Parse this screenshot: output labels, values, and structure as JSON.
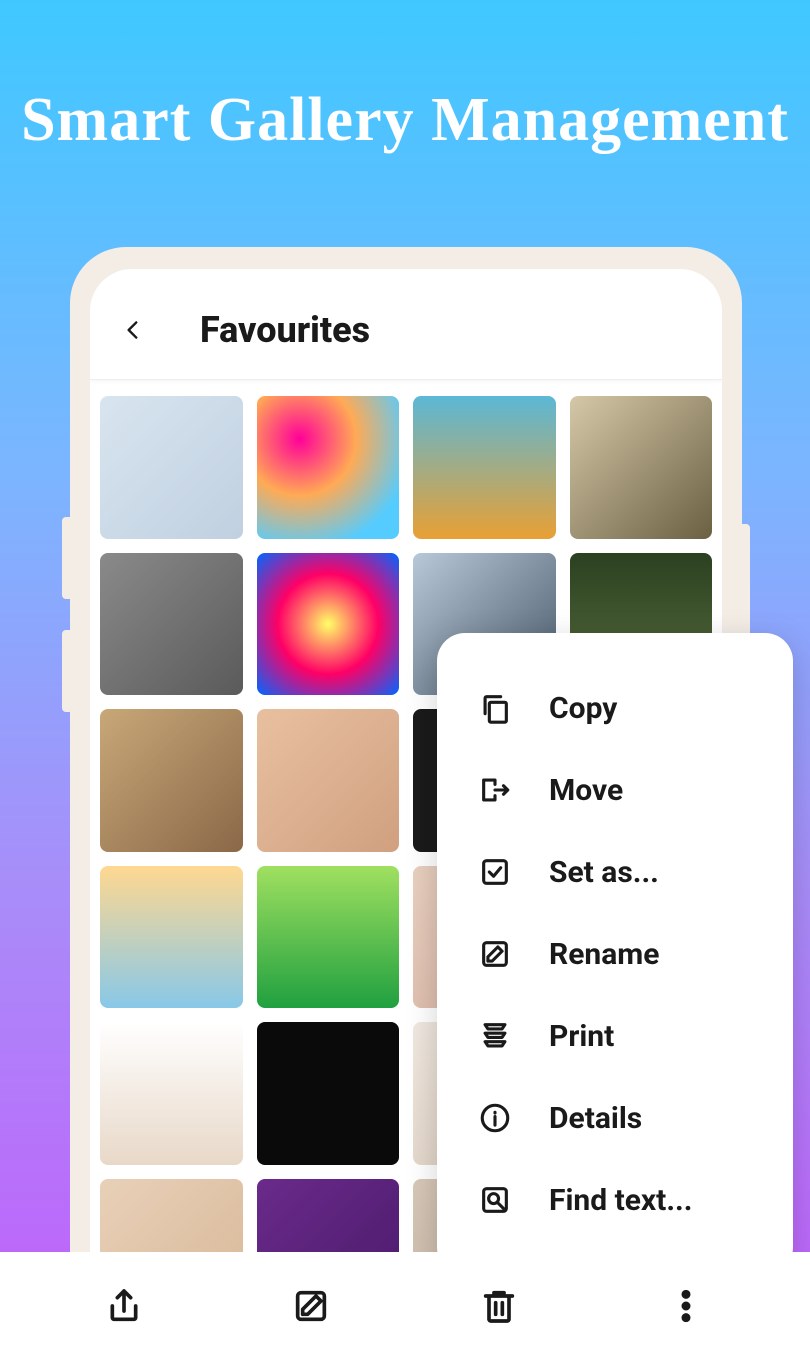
{
  "promo": {
    "title": "Smart Gallery Management"
  },
  "header": {
    "title": "Favourites"
  },
  "menu": {
    "items": [
      {
        "label": "Copy",
        "icon": "copy-icon"
      },
      {
        "label": "Move",
        "icon": "move-icon"
      },
      {
        "label": "Set as...",
        "icon": "setas-icon"
      },
      {
        "label": "Rename",
        "icon": "rename-icon"
      },
      {
        "label": "Print",
        "icon": "print-icon"
      },
      {
        "label": "Details",
        "icon": "details-icon"
      },
      {
        "label": "Find text...",
        "icon": "findtext-icon"
      }
    ]
  },
  "bottombar": {
    "items": [
      "share",
      "edit",
      "delete",
      "more"
    ]
  }
}
